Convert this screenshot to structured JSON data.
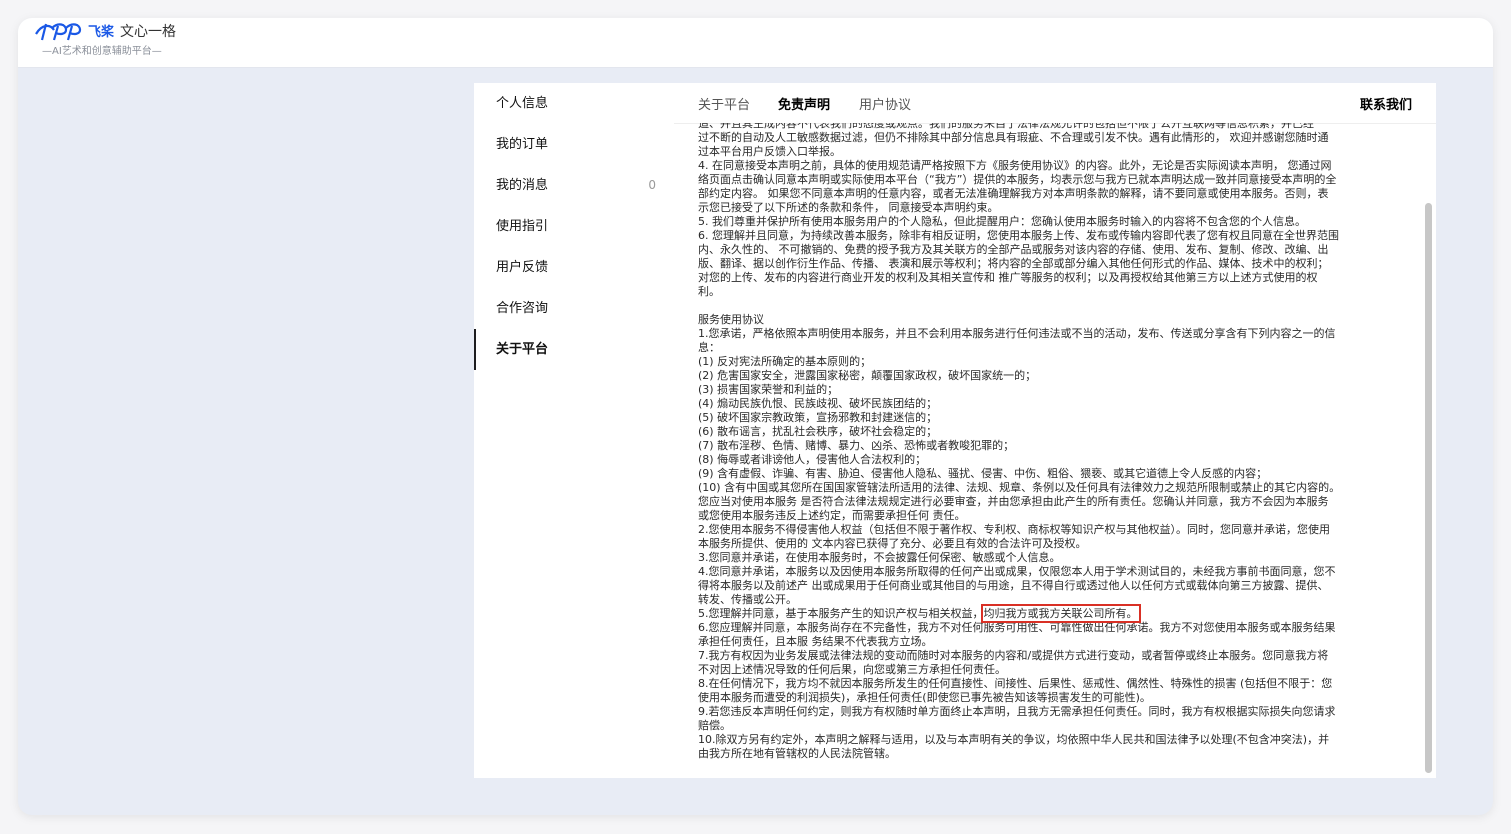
{
  "brand": {
    "name": "飞桨",
    "product": "文心一格",
    "tagline": "—AI艺术和创意辅助平台—"
  },
  "sidebar": {
    "items": [
      {
        "label": "个人信息"
      },
      {
        "label": "我的订单"
      },
      {
        "label": "我的消息",
        "badge": "0"
      },
      {
        "label": "使用指引"
      },
      {
        "label": "用户反馈"
      },
      {
        "label": "合作咨询"
      },
      {
        "label": "关于平台"
      }
    ],
    "active_index": 6
  },
  "tabs": {
    "items": [
      {
        "label": "关于平台"
      },
      {
        "label": "免责声明"
      },
      {
        "label": "用户协议"
      }
    ],
    "active_index": 1,
    "contact_label": "联系我们"
  },
  "content": {
    "lines": [
      "造、并且其生成内容不代表我们的态度或观点。我们的服务来自于法律法规允许的包括但不限于公开互联网等信息积累，并已经",
      "过不断的自动及人工敏感数据过滤，但仍不排除其中部分信息具有瑕疵、不合理或引发不快。遇有此情形的， 欢迎并感谢您随时通",
      "过本平台用户反馈入口举报。",
      "4. 在同意接受本声明之前，具体的使用规范请严格按照下方《服务使用协议》的内容。此外，无论是否实际阅读本声明， 您通过网",
      "络页面点击确认同意本声明或实际使用本平台（“我方”）提供的本服务，均表示您与我方已就本声明达成一致并同意接受本声明的全",
      "部约定内容。 如果您不同意本声明的任意内容，或者无法准确理解我方对本声明条款的解释，请不要同意或使用本服务。否则，表",
      "示您已接受了以下所述的条款和条件， 同意接受本声明约束。",
      "5. 我们尊重并保护所有使用本服务用户的个人隐私，但此提醒用户：您确认使用本服务时输入的内容将不包含您的个人信息。",
      "6. 您理解并且同意，为持续改善本服务，除非有相反证明，您使用本服务上传、发布或传输内容即代表了您有权且同意在全世界范围",
      "内、永久性的、 不可撤销的、免费的授予我方及其关联方的全部产品或服务对该内容的存储、使用、发布、复制、修改、改编、出",
      "版、翻译、据以创作衍生作品、传播、 表演和展示等权利；将内容的全部或部分编入其他任何形式的作品、媒体、技术中的权利；",
      "对您的上传、发布的内容进行商业开发的权利及其相关宣传和 推广等服务的权利；以及再授权给其他第三方以上述方式使用的权",
      "利。",
      "",
      "服务使用协议",
      "1.您承诺，严格依照本声明使用本服务，并且不会利用本服务进行任何违法或不当的活动，发布、传送或分享含有下列内容之一的信",
      "息：",
      "(1) 反对宪法所确定的基本原则的；",
      "(2) 危害国家安全，泄露国家秘密，颠覆国家政权，破坏国家统一的；",
      "(3) 损害国家荣誉和利益的；",
      "(4) 煽动民族仇恨、民族歧视、破坏民族团结的；",
      "(5) 破坏国家宗教政策，宣扬邪教和封建迷信的；",
      "(6) 散布谣言，扰乱社会秩序，破坏社会稳定的；",
      "(7) 散布淫秽、色情、赌博、暴力、凶杀、恐怖或者教唆犯罪的；",
      "(8) 侮辱或者诽谤他人，侵害他人合法权利的；",
      "(9) 含有虚假、诈骗、有害、胁迫、侵害他人隐私、骚扰、侵害、中伤、粗俗、猥亵、或其它道德上令人反感的内容；",
      "(10) 含有中国或其您所在国国家管辖法所适用的法律、法规、规章、条例以及任何具有法律效力之规范所限制或禁止的其它内容的。",
      "您应当对使用本服务 是否符合法律法规规定进行必要审查，并由您承担由此产生的所有责任。您确认并同意，我方不会因为本服务",
      "或您使用本服务违反上述约定，而需要承担任何 责任。",
      "2.您使用本服务不得侵害他人权益（包括但不限于著作权、专利权、商标权等知识产权与其他权益）。同时，您同意并承诺，您使用",
      "本服务所提供、使用的 文本内容已获得了充分、必要且有效的合法许可及授权。",
      "3.您同意并承诺，在使用本服务时，不会披露任何保密、敏感或个人信息。",
      "4.您同意并承诺，本服务以及因使用本服务所取得的任何产出或成果，仅限您本人用于学术测试目的，未经我方事前书面同意，您不",
      "得将本服务以及前述产 出或成果用于任何商业或其他目的与用途，且不得自行或透过他人以任何方式或载体向第三方披露、提供、",
      "转发、传播或公开。",
      "",
      "6.您应理解并同意，本服务尚存在不完备性，我方不对任何服务可用性、可靠性做出任何承诺。我方不对您使用本服务或本服务结果",
      "承担任何责任，且本服 务结果不代表我方立场。",
      "7.我方有权因为业务发展或法律法规的变动而随时对本服务的内容和/或提供方式进行变动，或者暂停或终止本服务。您同意我方将",
      "不对因上述情况导致的任何后果，向您或第三方承担任何责任。",
      "8.在任何情况下，我方均不就因本服务所发生的任何直接性、间接性、后果性、惩戒性、偶然性、特殊性的损害 (包括但不限于：您",
      "使用本服务而遭受的利润损失)，承担任何责任(即使您已事先被告知该等损害发生的可能性)。",
      "9.若您违反本声明任何约定，则我方有权随时单方面终止本声明，且我方无需承担任何责任。同时，我方有权根据实际损失向您请求",
      "赔偿。",
      "10.除双方另有约定外，本声明之解释与适用，以及与本声明有关的争议，均依照中华人民共和国法律予以处理(不包含冲突法)，并",
      "由我方所在地有管辖权的人民法院管辖。"
    ],
    "clause5_prefix": "5.您理解并同意，基于本服务产生的知识产权与相关权益，",
    "clause5_highlight": "均归我方或我方关联公司所有。"
  },
  "colors": {
    "brand_blue": "#1a58e6",
    "highlight_red": "#d93025"
  }
}
